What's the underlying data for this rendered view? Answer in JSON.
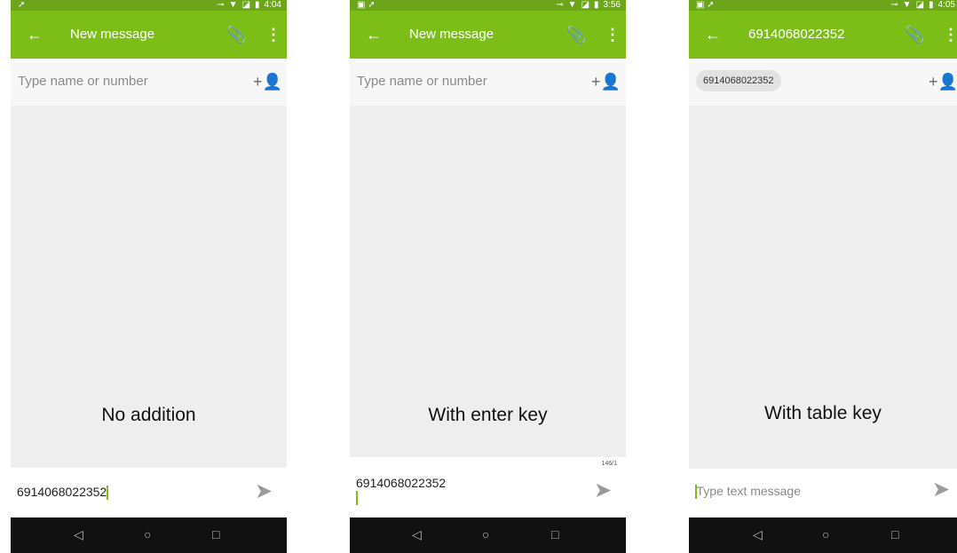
{
  "icons": {
    "back": "←",
    "clip": "📎",
    "more": "⋮",
    "add_person": "+👤",
    "send": "➤",
    "nav_back": "◁",
    "nav_home": "○",
    "nav_recent": "□",
    "key": "⊸",
    "wifi": "▼",
    "sim": "◪",
    "battery": "▮",
    "gallery": "▣",
    "airplane": "➚"
  },
  "colors": {
    "appbar": "#7cbd18",
    "statusbar": "#6da51a",
    "send": "#9a9a9a"
  },
  "screens": [
    {
      "time": "4:04",
      "title": "New message",
      "to_placeholder": "Type name or number",
      "compose_text": "6914068022352",
      "caption": "No addition"
    },
    {
      "time": "3:56",
      "title": "New message",
      "to_placeholder": "Type name or number",
      "compose_text": "6914068022352",
      "counter": "146/1",
      "caption": "With enter key"
    },
    {
      "time": "4:05",
      "title": "6914068022352",
      "recipient_chip": "6914068022352",
      "compose_placeholder": "Type text message",
      "caption": "With table key"
    }
  ]
}
